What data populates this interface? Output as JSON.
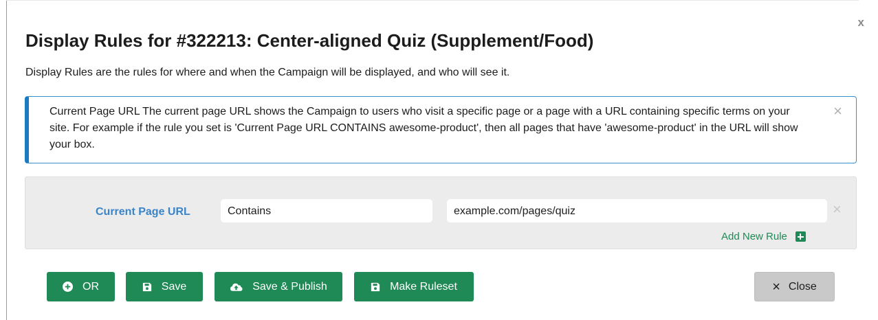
{
  "modal": {
    "corner_close": "x",
    "title": "Display Rules for #322213: Center-aligned Quiz (Supplement/Food)",
    "subtitle": "Display Rules are the rules for where and when the Campaign will be displayed, and who will see it."
  },
  "info": {
    "text": "Current Page URL The current page URL shows the Campaign to users who visit a specific page or a page with a URL containing specific terms on your site. For example if the rule you set is 'Current Page URL CONTAINS awesome-product', then all pages that have 'awesome-product' in the URL will show your box.",
    "close": "×"
  },
  "rule": {
    "label": "Current Page URL",
    "operator": "Contains",
    "value": "example.com/pages/quiz",
    "remove": "×",
    "add_label": "Add New Rule"
  },
  "buttons": {
    "or": "OR",
    "save": "Save",
    "save_publish": "Save & Publish",
    "make_ruleset": "Make Ruleset",
    "close": "Close",
    "close_icon": "×"
  },
  "colors": {
    "accent_green": "#1f8a55",
    "link_blue": "#3a84c7",
    "info_border": "#1a7bc2"
  },
  "icons": {
    "or": "plus-circle-icon",
    "save": "floppy-disk-icon",
    "save_publish": "cloud-upload-icon",
    "make_ruleset": "floppy-disk-icon",
    "add_rule": "plus-square-icon"
  }
}
